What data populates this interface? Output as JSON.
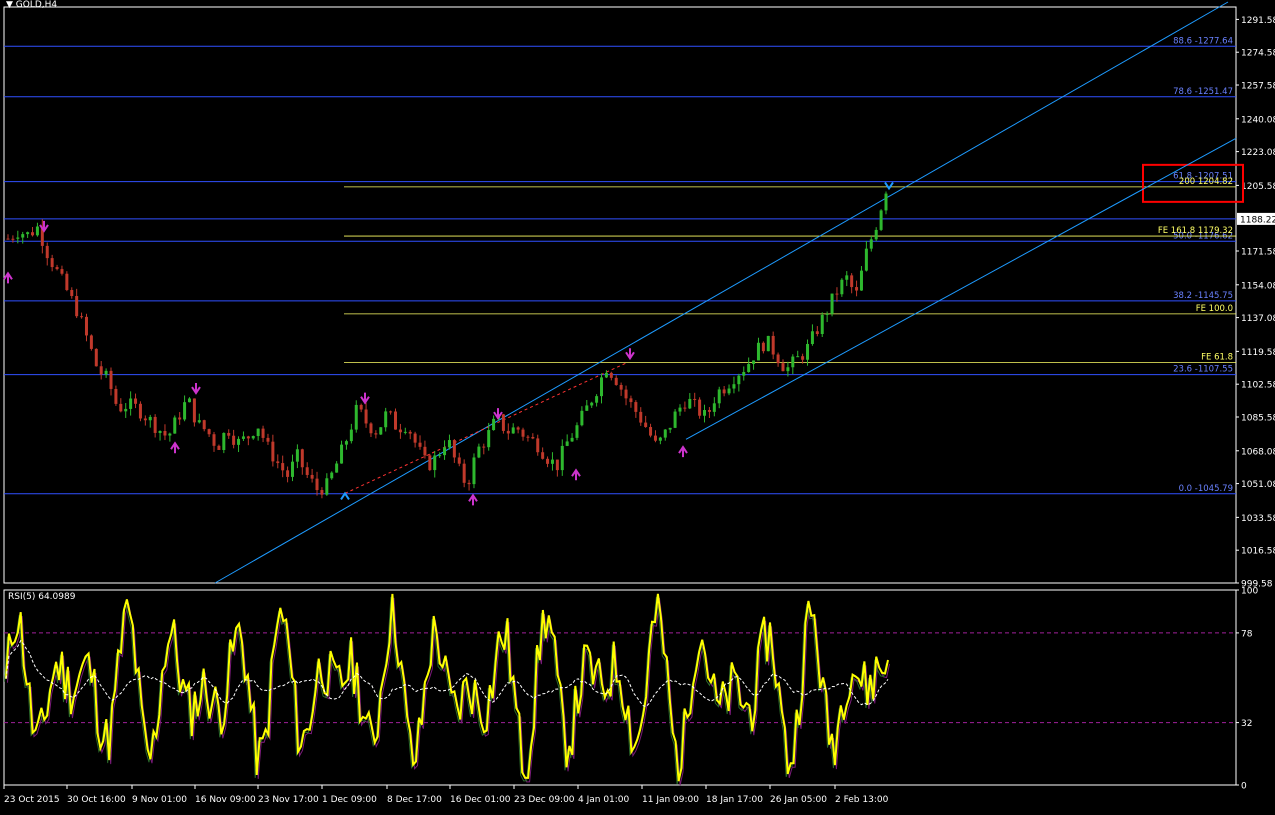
{
  "window": {
    "symbol_title": "GOLD,H4"
  },
  "colors": {
    "background": "#000000",
    "grid_frame": "#ffffff",
    "fib_retracement": "#3050ff",
    "fib_expansion": "#ffff66",
    "channel": "#1e9bff",
    "bull_candle": "#2eb82e",
    "bear_candle": "#c0392b",
    "arrow_marker": "#cc33cc",
    "rsi_main": "#ffff00",
    "rsi_shadow_a": "#7a1a7a",
    "rsi_shadow_b": "#2a6a2a",
    "rsi_ma": "#ffffff",
    "rsi_level": "#a0209a",
    "highlight_box": "#ff0000"
  },
  "chart_data": [
    {
      "type": "candlestick",
      "title": "GOLD,H4",
      "ylim": [
        999.58,
        1298
      ],
      "y_ticks": [
        "1291.58",
        "1274.58",
        "1257.58",
        "1240.08",
        "1223.08",
        "1205.58",
        "1188.22",
        "1171.58",
        "1154.08",
        "1137.08",
        "1119.58",
        "1102.58",
        "1085.58",
        "1068.08",
        "1051.08",
        "1033.58",
        "1016.58",
        "999.58"
      ],
      "current_price": "1188.22",
      "x_labels": [
        "23 Oct 2015",
        "30 Oct 16:00",
        "9 Nov 01:00",
        "16 Nov 09:00",
        "23 Nov 17:00",
        "1 Dec 09:00",
        "8 Dec 17:00",
        "16 Dec 01:00",
        "23 Dec 09:00",
        "4 Jan 01:00",
        "11 Jan 09:00",
        "18 Jan 17:00",
        "26 Jan 05:00",
        "2 Feb 13:00"
      ],
      "price_path": [
        1178,
        1182,
        1180,
        1184,
        1170,
        1160,
        1150,
        1140,
        1125,
        1110,
        1105,
        1090,
        1092,
        1090,
        1085,
        1080,
        1075,
        1085,
        1095,
        1082,
        1078,
        1070,
        1080,
        1072,
        1075,
        1082,
        1070,
        1062,
        1055,
        1065,
        1055,
        1048,
        1050,
        1062,
        1075,
        1090,
        1082,
        1078,
        1088,
        1080,
        1082,
        1070,
        1060,
        1065,
        1075,
        1060,
        1050,
        1068,
        1075,
        1085,
        1078,
        1080,
        1075,
        1072,
        1065,
        1060,
        1072,
        1080,
        1090,
        1100,
        1112,
        1105,
        1095,
        1088,
        1080,
        1070,
        1078,
        1088,
        1095,
        1090,
        1085,
        1098,
        1102,
        1108,
        1112,
        1120,
        1125,
        1118,
        1110,
        1115,
        1120,
        1130,
        1140,
        1150,
        1158,
        1148,
        1170,
        1185,
        1204
      ],
      "fib_retracement": [
        {
          "label": "88.6 -1277.64",
          "price": 1277.64
        },
        {
          "label": "78.6 -1251.47",
          "price": 1251.47
        },
        {
          "label": "61.8 -1207.51",
          "price": 1207.51
        },
        {
          "label": "50.0 -1176.62",
          "price": 1176.62
        },
        {
          "label": "38.2 -1145.75",
          "price": 1145.75
        },
        {
          "label": "23.6 -1107.55",
          "price": 1107.55
        },
        {
          "label": "0.0 -1045.79",
          "price": 1045.79
        }
      ],
      "fib_expansion": [
        {
          "label": "200 1204.82",
          "price": 1204.82
        },
        {
          "label": "FE 161.8 1179.32",
          "price": 1179.32
        },
        {
          "label": "FE 100.0",
          "price": 1139.0
        },
        {
          "label": "FE 61.8",
          "price": 1113.8
        }
      ],
      "extra_level": 1188.22,
      "highlight": {
        "label": "200 1204.82"
      }
    },
    {
      "type": "line",
      "title": "RSI(5) 64.0989",
      "ylim": [
        0,
        100
      ],
      "y_ticks": [
        "100",
        "78",
        "32",
        "0"
      ],
      "levels": [
        78,
        32
      ],
      "last_value": 64.0989
    }
  ]
}
